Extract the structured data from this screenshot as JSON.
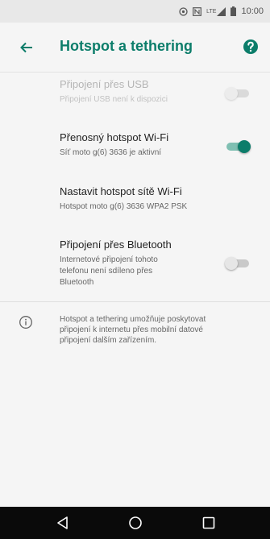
{
  "status_bar": {
    "network_label": "LTE",
    "time": "10:00"
  },
  "app_bar": {
    "title": "Hotspot a tethering",
    "back_icon": "arrow-back-icon",
    "help_icon": "help-icon"
  },
  "settings": [
    {
      "title": "Připojení přes USB",
      "summary": "Připojení USB není k dispozici",
      "enabled": false,
      "toggle_on": false
    },
    {
      "title": "Přenosný hotspot Wi-Fi",
      "summary": "Síť moto g(6) 3636 je aktivní",
      "enabled": true,
      "toggle_on": true
    },
    {
      "title": "Nastavit hotspot sítě Wi-Fi",
      "summary": "Hotspot moto g(6) 3636 WPA2 PSK",
      "enabled": true
    },
    {
      "title": "Připojení přes Bluetooth",
      "summary_lines": [
        "Internetové připojení tohoto",
        "telefonu není sdíleno přes",
        "Bluetooth"
      ],
      "enabled": true,
      "toggle_on": false
    }
  ],
  "info": {
    "icon": "info-icon",
    "lines": [
      "Hotspot a tethering umožňuje poskytovat",
      "připojení k internetu přes mobilní datové",
      "připojení dalším zařízením."
    ]
  },
  "nav_bar": {
    "back": "nav-back-icon",
    "home": "nav-home-icon",
    "recents": "nav-recents-icon"
  },
  "colors": {
    "accent": "#0c7d6a",
    "toggle_track_on": "#7fbfb2",
    "background": "#f5f5f5",
    "status_bar": "#e8e8e8",
    "nav_bar": "#0a0a0a"
  }
}
